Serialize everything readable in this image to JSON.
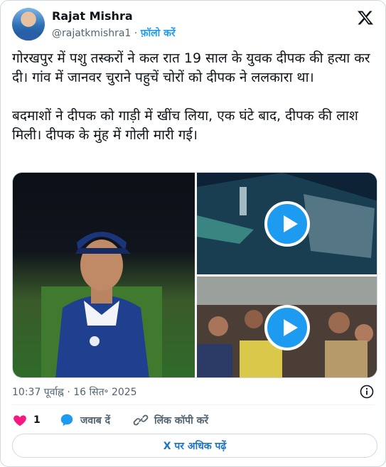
{
  "author": {
    "name": "Rajat Mishra",
    "handle": "@rajatkmishra1",
    "separator": "·",
    "follow_label": "फ़ॉलो करें"
  },
  "tweet": {
    "text": "गोरखपुर में पशु तस्करों ने कल रात 19 साल के युवक दीपक की हत्या कर दी। गांव में जानवर चुराने पहुचें चोरों को दीपक ने ललकारा था।\n\nबदमाशों ने दीपक को गाड़ी में खींच लिया, एक घंटे बाद, दीपक की लाश मिली। दीपक के मुंह में गोली मारी गई।",
    "timestamp": "10:37 पूर्वाह्न · 16 सित॰ 2025"
  },
  "media": [
    {
      "type": "photo",
      "label": "young man in blue jersey and cap on field"
    },
    {
      "type": "video",
      "label": "cctv night footage of vehicle"
    },
    {
      "type": "video",
      "label": "crowd gathered with police"
    }
  ],
  "actions": {
    "like_count": "1",
    "reply_label": "जवाब दें",
    "copy_link_label": "लिंक कॉपी करें"
  },
  "read_more_label": "X पर अधिक पढ़ें",
  "colors": {
    "accent": "#1d9bf0",
    "like": "#f91880",
    "text": "#0f1419",
    "muted": "#536471"
  }
}
